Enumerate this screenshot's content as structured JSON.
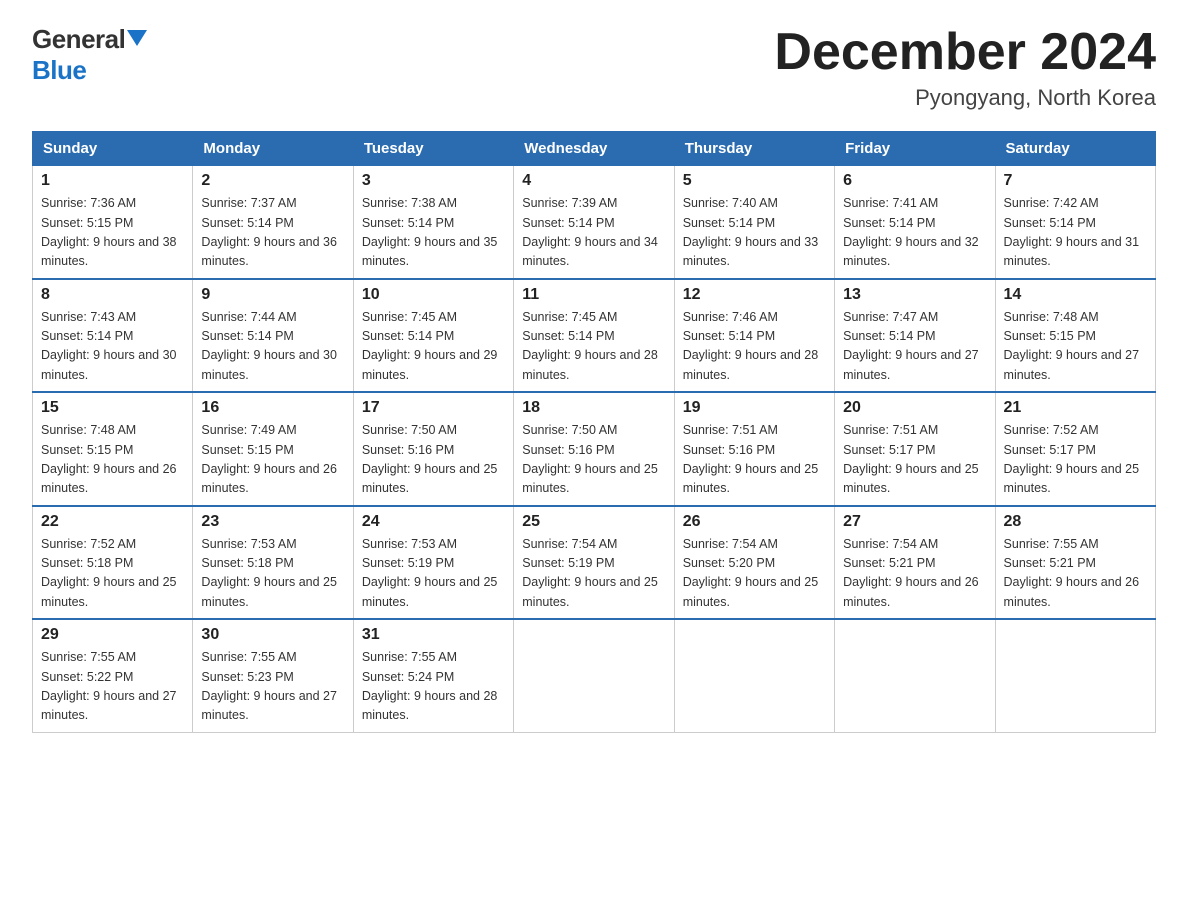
{
  "header": {
    "logo_general": "General",
    "logo_blue": "Blue",
    "month_title": "December 2024",
    "location": "Pyongyang, North Korea"
  },
  "days_of_week": [
    "Sunday",
    "Monday",
    "Tuesday",
    "Wednesday",
    "Thursday",
    "Friday",
    "Saturday"
  ],
  "weeks": [
    [
      {
        "day": "1",
        "sunrise": "7:36 AM",
        "sunset": "5:15 PM",
        "daylight": "9 hours and 38 minutes."
      },
      {
        "day": "2",
        "sunrise": "7:37 AM",
        "sunset": "5:14 PM",
        "daylight": "9 hours and 36 minutes."
      },
      {
        "day": "3",
        "sunrise": "7:38 AM",
        "sunset": "5:14 PM",
        "daylight": "9 hours and 35 minutes."
      },
      {
        "day": "4",
        "sunrise": "7:39 AM",
        "sunset": "5:14 PM",
        "daylight": "9 hours and 34 minutes."
      },
      {
        "day": "5",
        "sunrise": "7:40 AM",
        "sunset": "5:14 PM",
        "daylight": "9 hours and 33 minutes."
      },
      {
        "day": "6",
        "sunrise": "7:41 AM",
        "sunset": "5:14 PM",
        "daylight": "9 hours and 32 minutes."
      },
      {
        "day": "7",
        "sunrise": "7:42 AM",
        "sunset": "5:14 PM",
        "daylight": "9 hours and 31 minutes."
      }
    ],
    [
      {
        "day": "8",
        "sunrise": "7:43 AM",
        "sunset": "5:14 PM",
        "daylight": "9 hours and 30 minutes."
      },
      {
        "day": "9",
        "sunrise": "7:44 AM",
        "sunset": "5:14 PM",
        "daylight": "9 hours and 30 minutes."
      },
      {
        "day": "10",
        "sunrise": "7:45 AM",
        "sunset": "5:14 PM",
        "daylight": "9 hours and 29 minutes."
      },
      {
        "day": "11",
        "sunrise": "7:45 AM",
        "sunset": "5:14 PM",
        "daylight": "9 hours and 28 minutes."
      },
      {
        "day": "12",
        "sunrise": "7:46 AM",
        "sunset": "5:14 PM",
        "daylight": "9 hours and 28 minutes."
      },
      {
        "day": "13",
        "sunrise": "7:47 AM",
        "sunset": "5:14 PM",
        "daylight": "9 hours and 27 minutes."
      },
      {
        "day": "14",
        "sunrise": "7:48 AM",
        "sunset": "5:15 PM",
        "daylight": "9 hours and 27 minutes."
      }
    ],
    [
      {
        "day": "15",
        "sunrise": "7:48 AM",
        "sunset": "5:15 PM",
        "daylight": "9 hours and 26 minutes."
      },
      {
        "day": "16",
        "sunrise": "7:49 AM",
        "sunset": "5:15 PM",
        "daylight": "9 hours and 26 minutes."
      },
      {
        "day": "17",
        "sunrise": "7:50 AM",
        "sunset": "5:16 PM",
        "daylight": "9 hours and 25 minutes."
      },
      {
        "day": "18",
        "sunrise": "7:50 AM",
        "sunset": "5:16 PM",
        "daylight": "9 hours and 25 minutes."
      },
      {
        "day": "19",
        "sunrise": "7:51 AM",
        "sunset": "5:16 PM",
        "daylight": "9 hours and 25 minutes."
      },
      {
        "day": "20",
        "sunrise": "7:51 AM",
        "sunset": "5:17 PM",
        "daylight": "9 hours and 25 minutes."
      },
      {
        "day": "21",
        "sunrise": "7:52 AM",
        "sunset": "5:17 PM",
        "daylight": "9 hours and 25 minutes."
      }
    ],
    [
      {
        "day": "22",
        "sunrise": "7:52 AM",
        "sunset": "5:18 PM",
        "daylight": "9 hours and 25 minutes."
      },
      {
        "day": "23",
        "sunrise": "7:53 AM",
        "sunset": "5:18 PM",
        "daylight": "9 hours and 25 minutes."
      },
      {
        "day": "24",
        "sunrise": "7:53 AM",
        "sunset": "5:19 PM",
        "daylight": "9 hours and 25 minutes."
      },
      {
        "day": "25",
        "sunrise": "7:54 AM",
        "sunset": "5:19 PM",
        "daylight": "9 hours and 25 minutes."
      },
      {
        "day": "26",
        "sunrise": "7:54 AM",
        "sunset": "5:20 PM",
        "daylight": "9 hours and 25 minutes."
      },
      {
        "day": "27",
        "sunrise": "7:54 AM",
        "sunset": "5:21 PM",
        "daylight": "9 hours and 26 minutes."
      },
      {
        "day": "28",
        "sunrise": "7:55 AM",
        "sunset": "5:21 PM",
        "daylight": "9 hours and 26 minutes."
      }
    ],
    [
      {
        "day": "29",
        "sunrise": "7:55 AM",
        "sunset": "5:22 PM",
        "daylight": "9 hours and 27 minutes."
      },
      {
        "day": "30",
        "sunrise": "7:55 AM",
        "sunset": "5:23 PM",
        "daylight": "9 hours and 27 minutes."
      },
      {
        "day": "31",
        "sunrise": "7:55 AM",
        "sunset": "5:24 PM",
        "daylight": "9 hours and 28 minutes."
      },
      null,
      null,
      null,
      null
    ]
  ]
}
